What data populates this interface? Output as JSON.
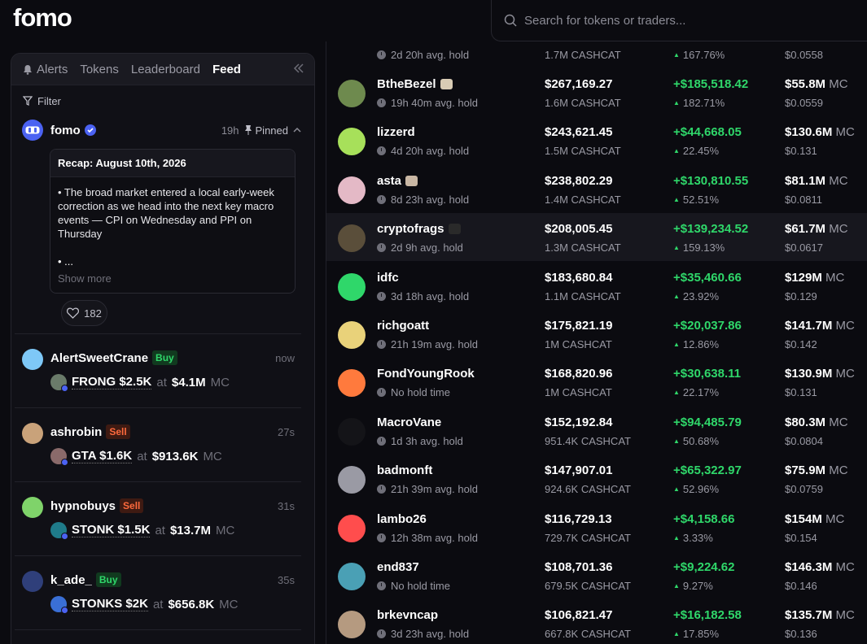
{
  "brand": {
    "logo": "fomo"
  },
  "search": {
    "placeholder": "Search for tokens or traders..."
  },
  "panel": {
    "tabs": [
      {
        "label": "Alerts",
        "icon": "bell-icon",
        "active": false
      },
      {
        "label": "Tokens",
        "active": false
      },
      {
        "label": "Leaderboard",
        "active": false
      },
      {
        "label": "Feed",
        "active": true
      }
    ],
    "collapse_icon": "double-chevron-left-icon",
    "filter_label": "Filter",
    "pinned_post": {
      "author": "fomo",
      "time": "19h",
      "pinned_label": "Pinned",
      "recap_title": "Recap: August 10th, 2026",
      "recap_body": "• The broad market entered a local early-week correction as we head into the next key macro events — CPI on Wednesday and PPI on Thursday",
      "recap_more": "• ...",
      "show_more": "Show more",
      "likes": "182"
    },
    "trades": [
      {
        "user": "AlertSweetCrane",
        "side": "Buy",
        "time": "now",
        "token": "FRONG",
        "amount": "$2.5K",
        "at": "at",
        "mc": "$4.1M",
        "mc_label": "MC",
        "avatar_color": "#7ec8f7",
        "token_color": "#6a7b6a"
      },
      {
        "user": "ashrobin",
        "side": "Sell",
        "time": "27s",
        "token": "GTA",
        "amount": "$1.6K",
        "at": "at",
        "mc": "$913.6K",
        "mc_label": "MC",
        "avatar_color": "#c9a27a",
        "token_color": "#8a6a6a"
      },
      {
        "user": "hypnobuys",
        "side": "Sell",
        "time": "31s",
        "token": "STONK",
        "amount": "$1.5K",
        "at": "at",
        "mc": "$13.7M",
        "mc_label": "MC",
        "avatar_color": "#7fd36a",
        "token_color": "#1f7b8a"
      },
      {
        "user": "k_ade_",
        "side": "Buy",
        "time": "35s",
        "token": "STONKS",
        "amount": "$2K",
        "at": "at",
        "mc": "$656.8K",
        "mc_label": "MC",
        "avatar_color": "#2f3f7a",
        "token_color": "#3a6fd6"
      }
    ]
  },
  "leaderboard": {
    "partial_top": {
      "hold": "2d 20h avg. hold",
      "qty": "1.7M CASHCAT",
      "pct": "167.76%",
      "price": "$0.0558"
    },
    "rows": [
      {
        "name": "BtheBezel",
        "hold": "19h 40m avg. hold",
        "value": "$267,169.27",
        "qty": "1.6M CASHCAT",
        "pnl": "+$185,518.42",
        "pct": "182.71%",
        "mcap": "$55.8M",
        "mc_unit": "MC",
        "price": "$0.0559",
        "avatar_color": "#6e8a4e",
        "badge_color": "#d8cbb4"
      },
      {
        "name": "lizzerd",
        "hold": "4d 20h avg. hold",
        "value": "$243,621.45",
        "qty": "1.5M CASHCAT",
        "pnl": "+$44,668.05",
        "pct": "22.45%",
        "mcap": "$130.6M",
        "mc_unit": "MC",
        "price": "$0.131",
        "avatar_color": "#a7e05a",
        "badge_color": ""
      },
      {
        "name": "asta",
        "hold": "8d 23h avg. hold",
        "value": "$238,802.29",
        "qty": "1.4M CASHCAT",
        "pnl": "+$130,810.55",
        "pct": "52.51%",
        "mcap": "$81.1M",
        "mc_unit": "MC",
        "price": "$0.0811",
        "avatar_color": "#e4b9c6",
        "badge_color": "#c9b7a4"
      },
      {
        "name": "cryptofrags",
        "hold": "2d 9h avg. hold",
        "value": "$208,005.45",
        "qty": "1.3M CASHCAT",
        "pnl": "+$139,234.52",
        "pct": "159.13%",
        "mcap": "$61.7M",
        "mc_unit": "MC",
        "price": "$0.0617",
        "avatar_color": "#5a4e3a",
        "badge_color": "#2a2a2a"
      },
      {
        "name": "idfc",
        "hold": "3d 18h avg. hold",
        "value": "$183,680.84",
        "qty": "1.1M CASHCAT",
        "pnl": "+$35,460.66",
        "pct": "23.92%",
        "mcap": "$129M",
        "mc_unit": "MC",
        "price": "$0.129",
        "avatar_color": "#2fd76a",
        "badge_color": ""
      },
      {
        "name": "richgoatt",
        "hold": "21h 19m avg. hold",
        "value": "$175,821.19",
        "qty": "1M CASHCAT",
        "pnl": "+$20,037.86",
        "pct": "12.86%",
        "mcap": "$141.7M",
        "mc_unit": "MC",
        "price": "$0.142",
        "avatar_color": "#e9d27a",
        "badge_color": ""
      },
      {
        "name": "FondYoungRook",
        "hold": "No hold time",
        "value": "$168,820.96",
        "qty": "1M CASHCAT",
        "pnl": "+$30,638.11",
        "pct": "22.17%",
        "mcap": "$130.9M",
        "mc_unit": "MC",
        "price": "$0.131",
        "avatar_color": "#ff7a3d",
        "badge_color": ""
      },
      {
        "name": "MacroVane",
        "hold": "1d 3h avg. hold",
        "value": "$152,192.84",
        "qty": "951.4K CASHCAT",
        "pnl": "+$94,485.79",
        "pct": "50.68%",
        "mcap": "$80.3M",
        "mc_unit": "MC",
        "price": "$0.0804",
        "avatar_color": "#141418",
        "badge_color": ""
      },
      {
        "name": "badmonft",
        "hold": "21h 39m avg. hold",
        "value": "$147,907.01",
        "qty": "924.6K CASHCAT",
        "pnl": "+$65,322.97",
        "pct": "52.96%",
        "mcap": "$75.9M",
        "mc_unit": "MC",
        "price": "$0.0759",
        "avatar_color": "#9a9aa4",
        "badge_color": ""
      },
      {
        "name": "lambo26",
        "hold": "12h 38m avg. hold",
        "value": "$116,729.13",
        "qty": "729.7K CASHCAT",
        "pnl": "+$4,158.66",
        "pct": "3.33%",
        "mcap": "$154M",
        "mc_unit": "MC",
        "price": "$0.154",
        "avatar_color": "#ff4d4d",
        "badge_color": ""
      },
      {
        "name": "end837",
        "hold": "No hold time",
        "value": "$108,701.36",
        "qty": "679.5K CASHCAT",
        "pnl": "+$9,224.62",
        "pct": "9.27%",
        "mcap": "$146.3M",
        "mc_unit": "MC",
        "price": "$0.146",
        "avatar_color": "#4aa0b5",
        "badge_color": ""
      },
      {
        "name": "brkevncap",
        "hold": "3d 23h avg. hold",
        "value": "$106,821.47",
        "qty": "667.8K CASHCAT",
        "pnl": "+$16,182.58",
        "pct": "17.85%",
        "mcap": "$135.7M",
        "mc_unit": "MC",
        "price": "$0.136",
        "avatar_color": "#b59a80",
        "badge_color": ""
      }
    ]
  }
}
